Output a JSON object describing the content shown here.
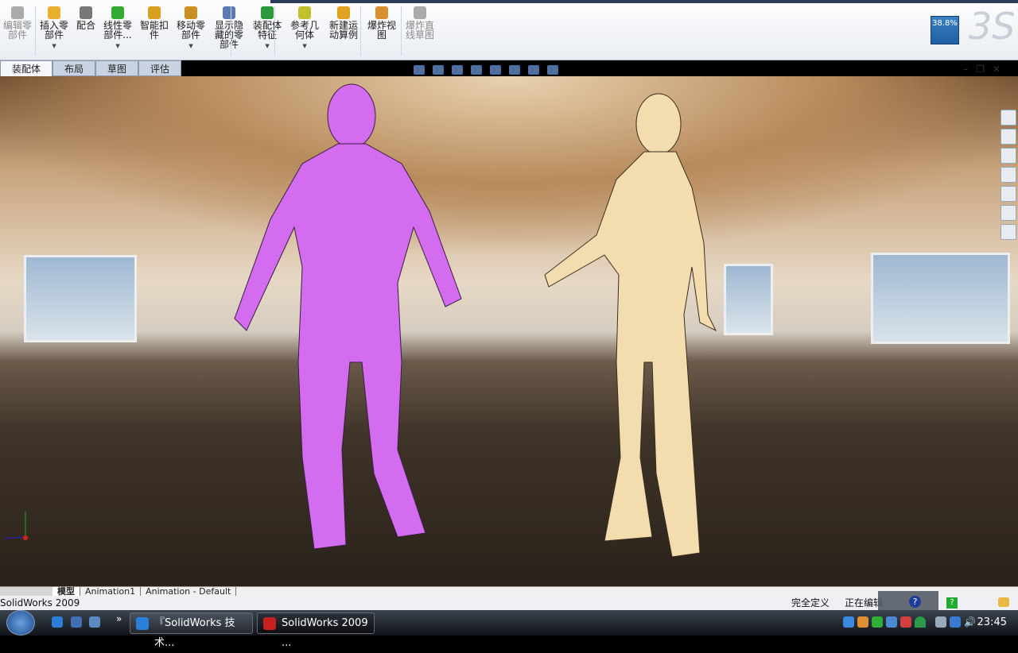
{
  "toolbar": {
    "items": [
      {
        "label": "编辑零\n部件",
        "disabled": true,
        "icon": "edit-component-icon"
      },
      {
        "label": "插入零\n部件",
        "dropdown": true,
        "icon": "insert-component-icon"
      },
      {
        "label": "配合",
        "icon": "mate-icon"
      },
      {
        "label": "线性零\n部件...",
        "dropdown": true,
        "icon": "linear-pattern-icon"
      },
      {
        "label": "智能扣\n件",
        "icon": "smart-fasteners-icon"
      },
      {
        "label": "移动零\n部件",
        "dropdown": true,
        "icon": "move-component-icon"
      },
      {
        "label": "显示隐\n藏的零\n部件",
        "icon": "show-hidden-icon"
      },
      {
        "label": "装配体\n特征",
        "dropdown": true,
        "icon": "assembly-features-icon"
      },
      {
        "label": "参考几\n何体",
        "dropdown": true,
        "icon": "reference-geometry-icon"
      },
      {
        "label": "新建运\n动算例",
        "icon": "new-motion-study-icon"
      },
      {
        "label": "爆炸视\n图",
        "icon": "exploded-view-icon"
      },
      {
        "label": "爆炸直\n线草图",
        "disabled": true,
        "icon": "explode-line-sketch-icon"
      }
    ],
    "zoom_badge": "38.8%"
  },
  "tabs": [
    "装配体",
    "布局",
    "草图",
    "评估"
  ],
  "bottom_tabs": [
    "模型",
    "Animation1",
    "Animation - Default"
  ],
  "status": {
    "app": "SolidWorks 2009",
    "state": "完全定义",
    "editing": "正在编辑"
  },
  "taskbar": {
    "tasks": [
      "『SolidWorks 技术...",
      "SolidWorks 2009 ..."
    ],
    "clock": "23:45"
  },
  "colors": {
    "figure_left": "#d46cf0",
    "figure_right": "#f3dcae"
  }
}
